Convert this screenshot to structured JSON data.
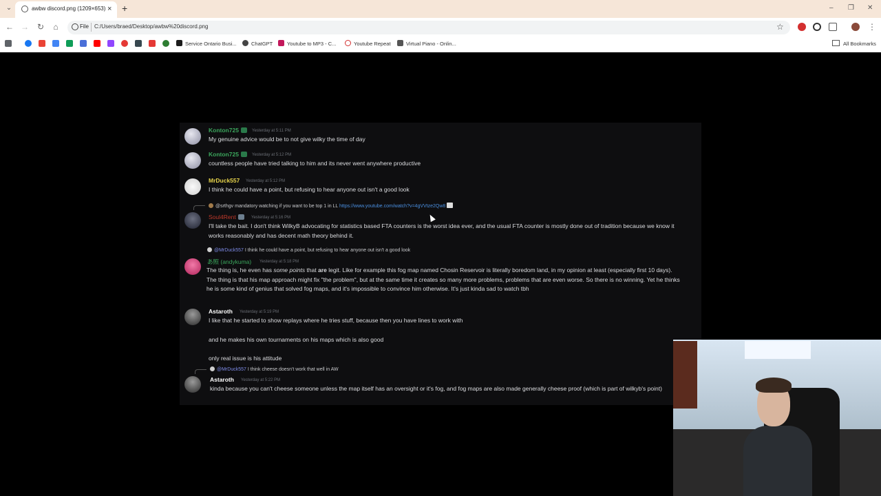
{
  "browser": {
    "tab_title": "awbw discord.png (1209×653)",
    "tab_close": "×",
    "new_tab": "+",
    "scheme_label": "File",
    "url": "C:/Users/braed/Desktop/awbw%20discord.png",
    "window_controls": [
      "–",
      "❐",
      "✕"
    ]
  },
  "bookmarks": {
    "items": [
      {
        "label": "Service Ontario Busi...",
        "color": "#1c1c1c"
      },
      {
        "label": "ChatGPT",
        "color": "#444444"
      },
      {
        "label": "Youtube to MP3 - C...",
        "color": "#c2185b"
      },
      {
        "label": "Youtube Repeat",
        "color": "#d32f2f"
      },
      {
        "label": "Virtual Piano - Onlin...",
        "color": "#555555"
      }
    ],
    "all_bookmarks": "All Bookmarks"
  },
  "chat": {
    "messages": [
      {
        "user": "Konton725",
        "time": "Yesterday at 5:11 PM",
        "text": "My genuine advice would be to not give wilky the time of day",
        "user_color": "#3ba55c"
      },
      {
        "user": "Konton725",
        "time": "Yesterday at 5:12 PM",
        "text": "countless people have tried talking to him and its never went anywhere productive",
        "user_color": "#3ba55c"
      },
      {
        "user": "MrDuck557",
        "time": "Yesterday at 5:12 PM",
        "text": "I think he could have a point, but refusing to hear anyone out isn't a good look",
        "user_color": "#e6d34b"
      },
      {
        "reply_mention": "@srthgv",
        "reply_text": "mandatory watching if you want to be top 1 in LL",
        "reply_link": "https://www.youtube.com/watch?v=4gVVtze2Qw8",
        "user": "Soul4Rent",
        "time": "Yesterday at 5:16 PM",
        "text": "I'll take the bait. I don't think WilkyB advocating for statistics based FTA counters is the worst idea ever, and the usual FTA counter is mostly done out of tradition because we know it works reasonably and has decent math theory behind it.",
        "user_color": "#c0392b"
      },
      {
        "reply_mention": "@MrDuck557",
        "reply_text": "I think he could have a point, but refusing to hear anyone out isn't a good look",
        "user": "あ照 (andykuma)",
        "time": "Yesterday at 5:18 PM",
        "text_parts": [
          "The thing is, he even has ",
          "some points",
          " that ",
          "are",
          " legit. Like for example this fog map named Chosin Reservoir is literally boredom land, in my opinion at least (especially first 10 days). The thing is that his map approach might fix \"the problem\", but at the same time it creates so many more problems, problems that are even worse. So there is no winning. Yet he thinks he is some kind of genius that solved fog maps, and it's impossible to convince him otherwise. It's just kinda sad to watch tbh"
        ],
        "user_color": "#3ba55c"
      },
      {
        "user": "Astaroth",
        "time": "Yesterday at 5:19 PM",
        "lines": [
          "I like that he started to show replays where he tries stuff, because then you have lines to work with",
          "and he makes his own tournaments on his maps which is also good",
          "only real issue is his attitude"
        ],
        "user_color": "#ffffff"
      },
      {
        "reply_mention": "@MrDuck557",
        "reply_text": "I think cheese doesn't work that well in AW",
        "user": "Astaroth",
        "time": "Yesterday at 5:22 PM",
        "text": "kinda because you can't cheese someone unless the map itself has an oversight or it's fog, and fog maps are also made generally cheese proof (which is part of wilkyb's point)",
        "user_color": "#ffffff"
      }
    ]
  }
}
